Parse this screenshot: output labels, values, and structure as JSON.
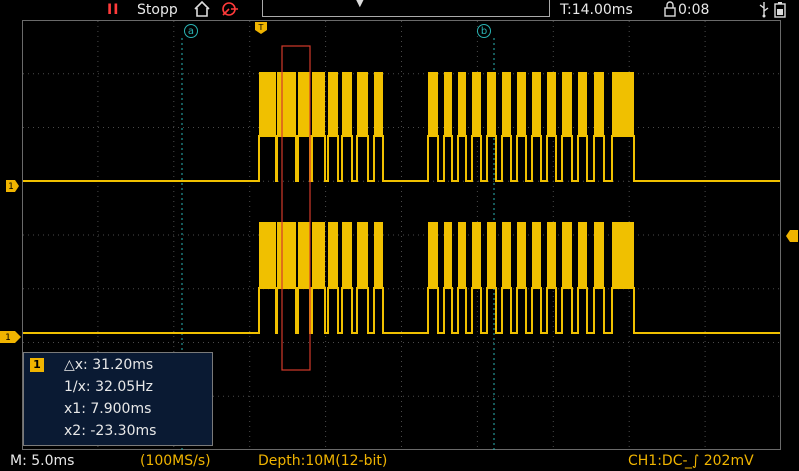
{
  "topbar": {
    "run_state_icon": "II",
    "run_state_label": "Stopp",
    "time_position": "T:14.00ms",
    "timer_label": "0:08",
    "trigger_marker": "▼",
    "icons": [
      "pause-icon",
      "home-icon",
      "probe-icon",
      "timer-lock-icon",
      "usb-icon",
      "battery-icon"
    ]
  },
  "cursors": {
    "a_label": "a",
    "b_label": "b",
    "trigger_label": "T",
    "color": "#2ab4b4"
  },
  "channel_markers": {
    "ch1": "1",
    "ch2": "1"
  },
  "cursor_panel": {
    "channel": "1",
    "delta_x": "△x: 31.20ms",
    "inverse_x": "1/x: 32.05Hz",
    "x1": "x1: 7.900ms",
    "x2": "x2: -23.30ms"
  },
  "bottombar": {
    "timebase": "M: 5.0ms",
    "sample_rate": "(100MS/s)",
    "depth": "Depth:10M(12-bit)",
    "channel_info": "CH1:DC-  ̲∫ 202mV"
  },
  "colors": {
    "trace": "#f0c000",
    "grid": "#6a6a6a",
    "accent_yellow": "#f0b400",
    "run_red": "#ff3a3a",
    "zoom_box": "#d23a2a"
  }
}
